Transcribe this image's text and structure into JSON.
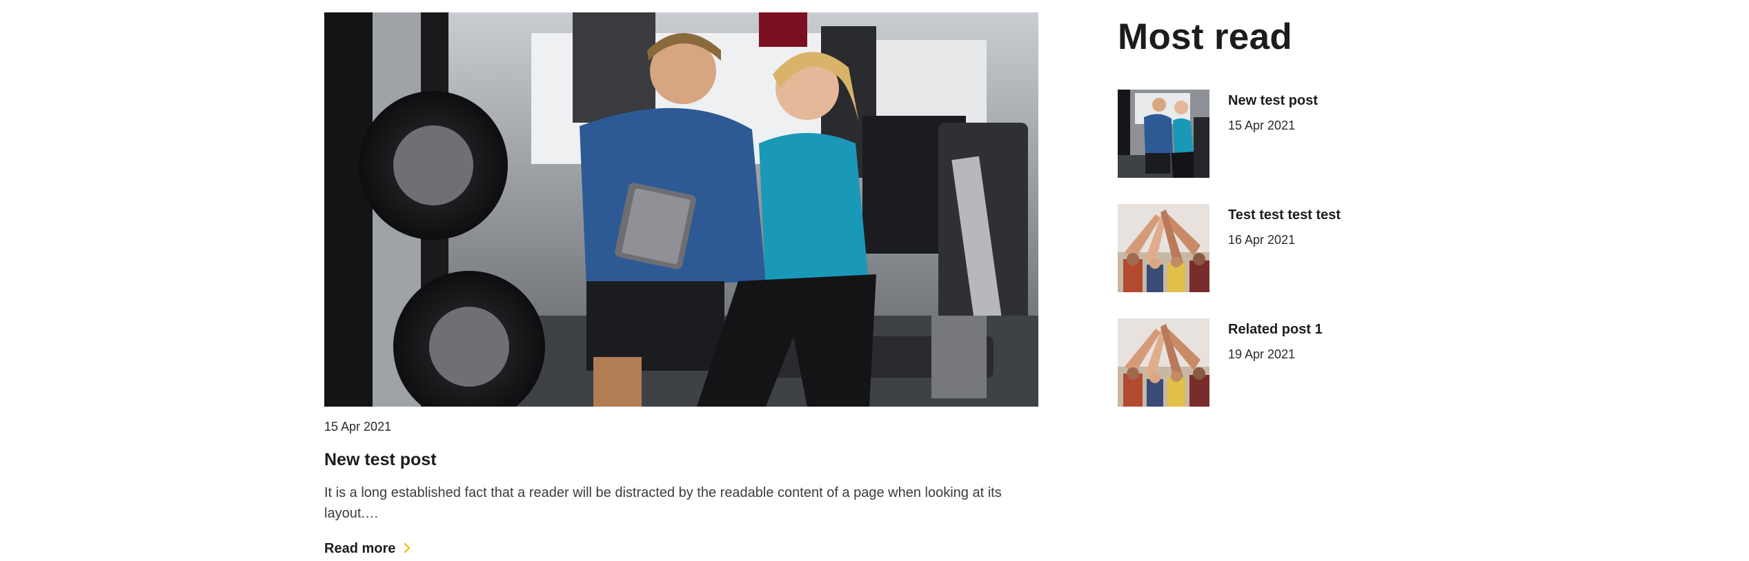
{
  "featured": {
    "date": "15 Apr 2021",
    "title": "New test post",
    "excerpt": "It is a long established fact that a reader will be distracted by the readable content of a page when looking at its layout.…",
    "read_more": "Read more",
    "image": "gym-couple-tablet-photo",
    "accent_color": "#f5b800"
  },
  "sidebar": {
    "title": "Most read",
    "items": [
      {
        "title": "New test post",
        "date": "15 Apr 2021",
        "image": "gym-couple-tablet-photo"
      },
      {
        "title": "Test test test test",
        "date": "16 Apr 2021",
        "image": "team-high-five-photo"
      },
      {
        "title": "Related post 1",
        "date": "19 Apr 2021",
        "image": "team-high-five-photo"
      }
    ]
  }
}
